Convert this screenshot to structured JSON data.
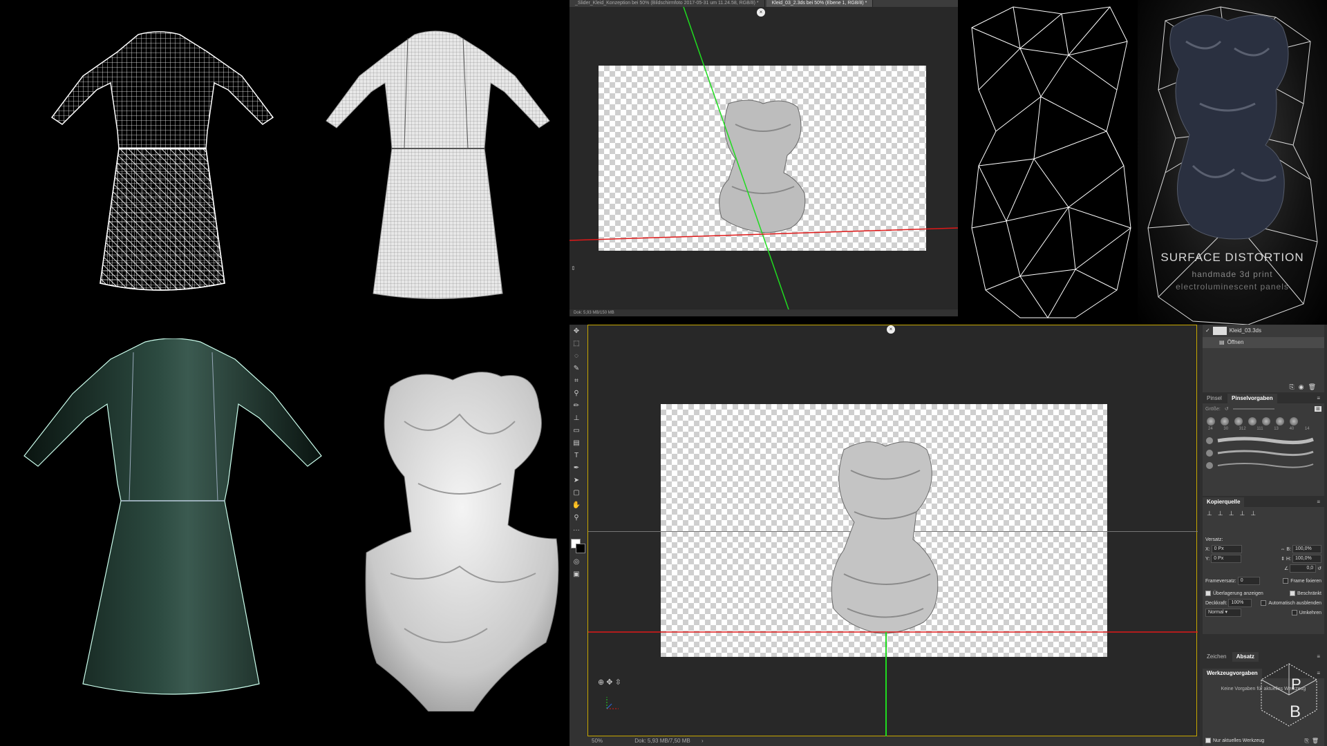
{
  "top_doc": {
    "tabs": [
      {
        "label": "_Slider_Kleid_Konzeption bei 50% (Bildschirmfoto 2017-05-31 um 11.24.58, RGB/8) *"
      },
      {
        "label": "Kleid_03_2.3ds bei 50% (Ebene 1, RGB/8) *"
      }
    ],
    "status": "Dok: 5,93 MB/150 MB"
  },
  "overlay": {
    "title": "SURFACE DISTORTION",
    "line1": "handmade 3d print",
    "line2": "electroluminescent panels"
  },
  "bottom_doc": {
    "zoom": "50%",
    "status": "Dok: 5,93 MB/7,50 MB"
  },
  "history_panel": {
    "item1": "Kleid_03.3ds",
    "item2": "Öffnen"
  },
  "brush_panel": {
    "tab1": "Pinsel",
    "tab2": "Pinselvorgaben",
    "size_label": "Größe:",
    "sizes": [
      "24",
      "30",
      "312",
      "111",
      "13",
      "40",
      "14"
    ]
  },
  "clone_panel": {
    "title": "Kopierquelle",
    "offset_label": "Versatz:",
    "x_label": "X:",
    "x_value": "0 Px",
    "y_label": "Y:",
    "y_value": "0 Px",
    "w_label": "B:",
    "w_value": "100,0%",
    "h_label": "H:",
    "h_value": "100,0%",
    "angle_value": "0,0",
    "frame_offset_label": "Frameversatz:",
    "frame_offset_value": "0",
    "frame_lock": "Frame fixieren",
    "show_overlay": "Überlagerung anzeigen",
    "clipped": "Beschränkt",
    "opacity_label": "Deckkraft:",
    "opacity_value": "100%",
    "auto_hide": "Automatisch ausblenden",
    "blend_mode": "Normal",
    "invert": "Umkehren"
  },
  "char_tabs": {
    "tab1": "Zeichen",
    "tab2": "Absatz"
  },
  "tool_presets": {
    "title": "Werkzeugvorgaben",
    "empty": "Keine Vorgaben für aktuelles Werkzeug",
    "current_only": "Nur aktuelles Werkzeug"
  },
  "logo": {
    "letter1": "P",
    "letter2": "B"
  },
  "colors": {
    "guide_green": "#1fdc1f",
    "guide_red": "#e01818",
    "ps_bg": "#282828",
    "panel_bg": "#3a3a3a"
  }
}
